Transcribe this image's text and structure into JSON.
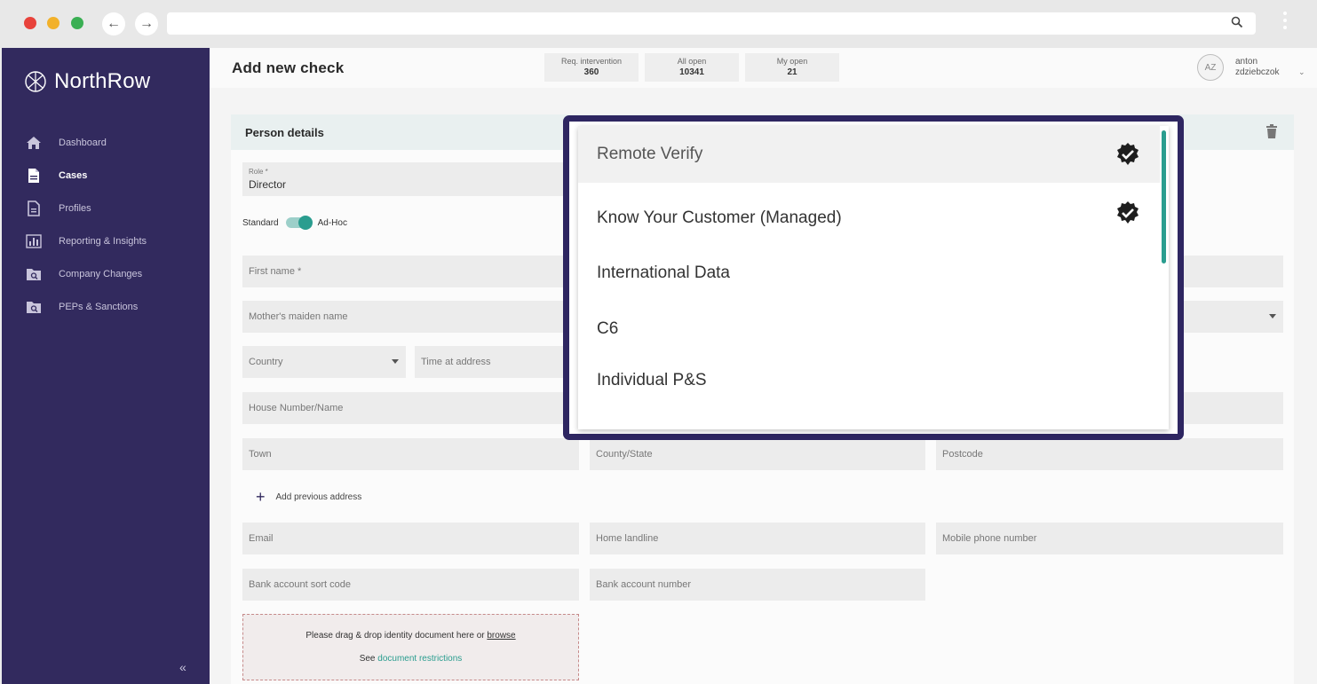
{
  "app": {
    "brand": "NorthRow",
    "page_title": "Add new check"
  },
  "colors": {
    "sidebar": "#322a5e",
    "accent": "#2a9d8f",
    "highlight_border": "#2e2661"
  },
  "sidebar": {
    "items": [
      {
        "label": "Dashboard",
        "icon": "home-icon",
        "active": false
      },
      {
        "label": "Cases",
        "icon": "document-icon",
        "active": true
      },
      {
        "label": "Profiles",
        "icon": "profile-document-icon",
        "active": false
      },
      {
        "label": "Reporting & Insights",
        "icon": "bar-chart-icon",
        "active": false
      },
      {
        "label": "Company Changes",
        "icon": "folder-search-icon",
        "active": false
      },
      {
        "label": "PEPs & Sanctions",
        "icon": "folder-search-icon",
        "active": false
      }
    ],
    "collapse_label": "«"
  },
  "header": {
    "stats": [
      {
        "label": "Req. intervention",
        "value": "360"
      },
      {
        "label": "All open",
        "value": "10341"
      },
      {
        "label": "My open",
        "value": "21"
      }
    ],
    "user": {
      "initials": "AZ",
      "first_name": "anton",
      "last_name": "zdziebczok"
    }
  },
  "form": {
    "section_title": "Person details",
    "role": {
      "label": "Role *",
      "value": "Director"
    },
    "toggle": {
      "left_label": "Standard",
      "right_label": "Ad-Hoc"
    },
    "placeholders": {
      "first_name": "First name *",
      "mothers_maiden_name": "Mother's maiden name",
      "country": "Country",
      "time_at_address": "Time at address",
      "house_number": "House Number/Name",
      "town": "Town",
      "county_state": "County/State",
      "postcode": "Postcode",
      "email": "Email",
      "home_landline": "Home landline",
      "mobile": "Mobile phone number",
      "sort_code": "Bank account sort code",
      "account_number": "Bank account number"
    },
    "add_previous_address": "Add previous address",
    "dropzone": {
      "text": "Please drag & drop identity document here or",
      "browse": "browse",
      "see": "See",
      "restrictions": "document restrictions"
    }
  },
  "dropdown": {
    "options": [
      {
        "label": "Remote Verify",
        "checked": true
      },
      {
        "label": "Know Your Customer (Managed)",
        "checked": true
      },
      {
        "label": "International Data",
        "checked": false
      },
      {
        "label": "C6",
        "checked": false
      },
      {
        "label": "Individual P&S",
        "checked": false
      }
    ]
  }
}
